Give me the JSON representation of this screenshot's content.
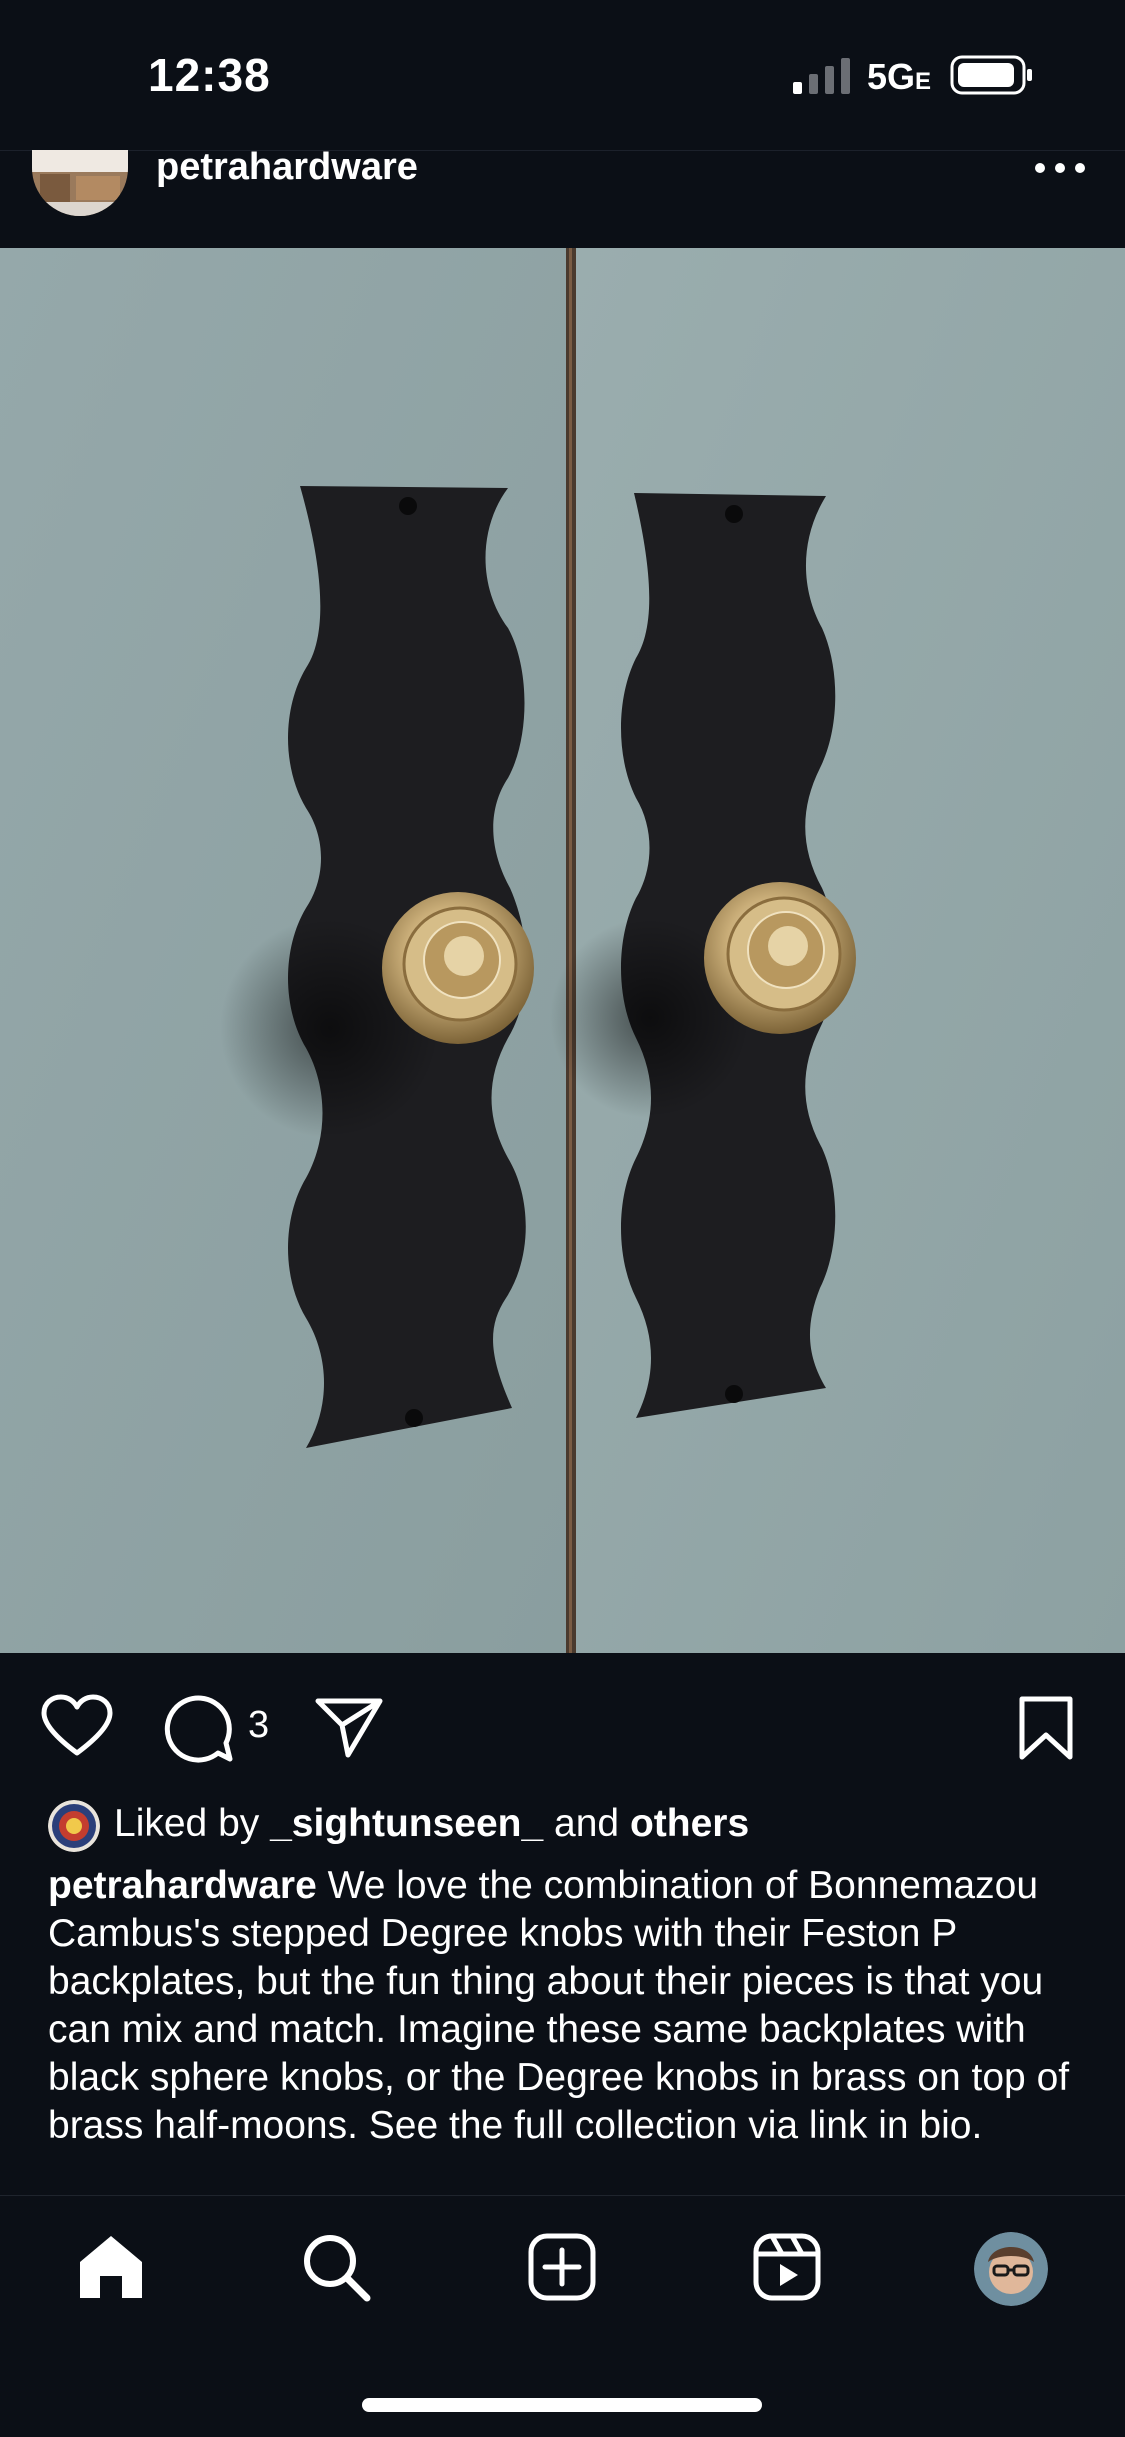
{
  "status_bar": {
    "time": "12:38",
    "network": "5G",
    "network_suffix": "E"
  },
  "post": {
    "username": "petrahardware",
    "image_alt": "Two black scalloped backplates with brass stepped knobs on pale blue cabinet doors",
    "comment_count": "3",
    "likes": {
      "prefix": "Liked by",
      "user": "_sightunseen_",
      "connector": "and",
      "others": "others"
    },
    "caption": {
      "author": "petrahardware",
      "text": "We love the combination of Bonnemazou Cambus's stepped Degree knobs with their Feston P backplates, but the fun thing about their pieces is that you can mix and match. Imagine these same backplates with black sphere knobs, or the Degree knobs in brass on top of brass half-moons. See the full collection via link in bio."
    }
  },
  "icons": {
    "header": [
      "more-icon"
    ],
    "actions": [
      "heart-icon",
      "comment-icon",
      "send-icon",
      "bookmark-icon"
    ],
    "nav": [
      "home-icon",
      "search-icon",
      "create-icon",
      "reels-icon",
      "profile-avatar"
    ]
  },
  "colors": {
    "background": "#0b0f16",
    "door": "#8fa3a5",
    "backplate": "#1c1c1e",
    "brass": "#c4a872",
    "text": "#ffffff"
  }
}
